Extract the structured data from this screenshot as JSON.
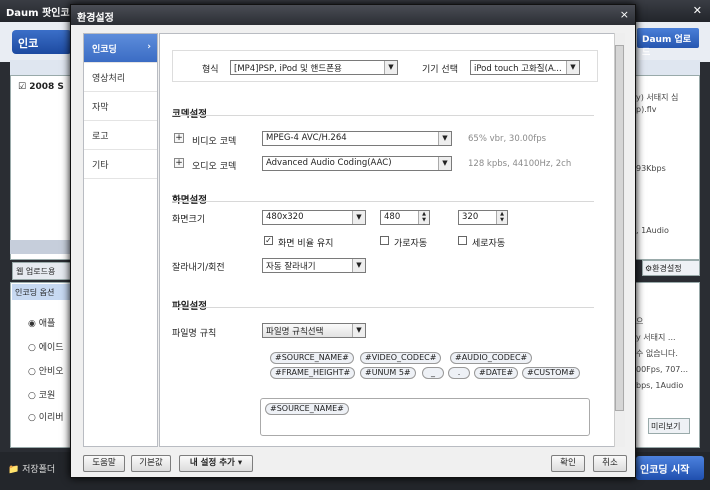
{
  "background_app": {
    "title": "Daum 팟인코더",
    "logo_text": "인코",
    "upload_button": "Daum 업로드",
    "list_row": "2008 S",
    "right_text_1": "y) 서태지 심",
    "right_text_1b": "p).flv",
    "right_text_2": "93Kbps",
    "right_text_3": ", 1Audio",
    "web_upload_tab": "웹 업로드용",
    "encoding_settings_button": "환경설정",
    "encoding_options_header": "인코딩 옵션",
    "radio_items": [
      "애플",
      "에이드",
      "안비오",
      "코원",
      "이리버"
    ],
    "right_text_4": [
      "으",
      "y 서태지 ...",
      "수 없습니다.",
      "00Fps, 707...",
      "bps, 1Audio"
    ],
    "preview_button": "미리보기",
    "save_folder": "저장폴더",
    "start_button": "인코딩 시작"
  },
  "dialog": {
    "title": "환경설정",
    "nav": [
      {
        "label": "인코딩",
        "active": true
      },
      {
        "label": "영상처리",
        "active": false
      },
      {
        "label": "자막",
        "active": false
      },
      {
        "label": "로고",
        "active": false
      },
      {
        "label": "기타",
        "active": false
      }
    ],
    "format_label": "형식",
    "format_value": "[MP4]PSP, iPod 및 핸드폰용",
    "device_label": "기기 선택",
    "device_value": "iPod touch 고화질(A...",
    "codec_section": "코덱설정",
    "video_codec_label": "비디오 코덱",
    "video_codec_value": "MPEG-4 AVC/H.264",
    "video_codec_hint": "65% vbr, 30.00fps",
    "audio_codec_label": "오디오 코덱",
    "audio_codec_value": "Advanced Audio Coding(AAC)",
    "audio_codec_hint": "128 kpbs, 44100Hz, 2ch",
    "screen_section": "화면설정",
    "screen_size_label": "화면크기",
    "screen_size_value": "480x320",
    "width_value": "480",
    "height_value": "320",
    "keep_ratio_label": "화면 비율 유지",
    "auto_width_label": "가로자동",
    "auto_height_label": "세로자동",
    "crop_label": "잘라내기/회전",
    "crop_value": "자동 잘라내기",
    "file_section": "파일설정",
    "filename_rule_label": "파일명 규칙",
    "filename_rule_button": "파일명 규칙선택",
    "tokens_row1": [
      "#SOURCE_NAME#",
      "#VIDEO_CODEC#",
      "#AUDIO_CODEC#"
    ],
    "tokens_row2": [
      "#FRAME_HEIGHT#",
      "#UNUM 5#",
      "_",
      ".",
      "#DATE#",
      "#CUSTOM#"
    ],
    "format_token": "#SOURCE_NAME#",
    "help_button": "도움말",
    "default_button": "기본값",
    "my_settings_button": "내 설정 추가",
    "ok_button": "확인",
    "cancel_button": "취소"
  },
  "colors": {
    "nav_active": "#3b6cc4",
    "title_bar": "#2b2e34"
  }
}
